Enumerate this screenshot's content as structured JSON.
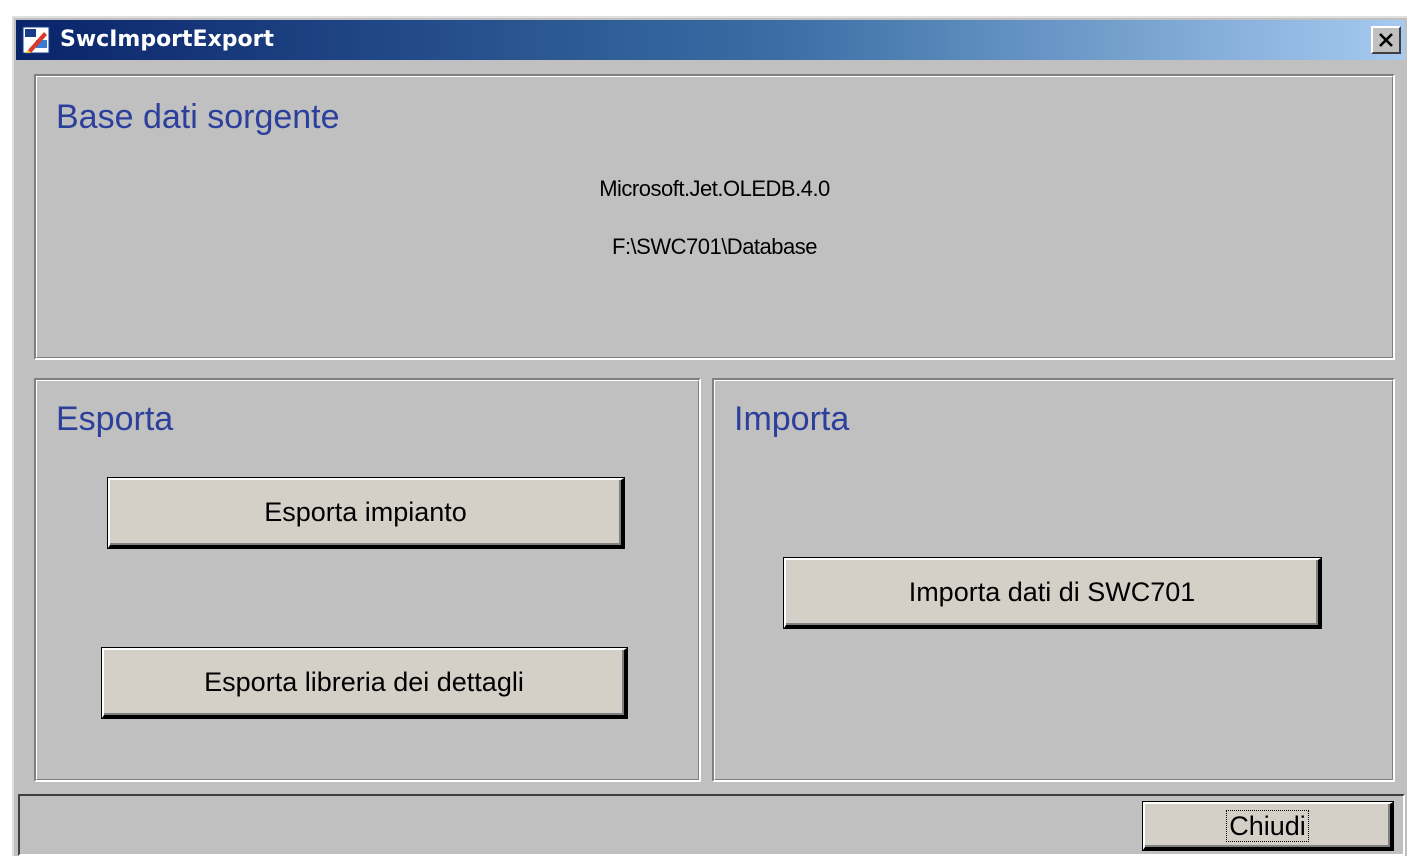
{
  "window": {
    "title": "SwcImportExport",
    "title_icon": "app-icon",
    "close_glyph": "✕",
    "colors": {
      "title_gradient_start": "#0a246a",
      "title_gradient_end": "#a6caf0",
      "face": "#c0c0c0",
      "heading": "#2b3f9b"
    }
  },
  "source": {
    "heading": "Base dati sorgente",
    "provider": "Microsoft.Jet.OLEDB.4.0",
    "path": "F:\\SWC701\\Database"
  },
  "export": {
    "heading": "Esporta",
    "buttons": {
      "plant": "Esporta impianto",
      "library": "Esporta libreria dei dettagli"
    }
  },
  "import": {
    "heading": "Importa",
    "buttons": {
      "data": "Importa dati di SWC701"
    }
  },
  "footer": {
    "close_label": "Chiudi"
  }
}
